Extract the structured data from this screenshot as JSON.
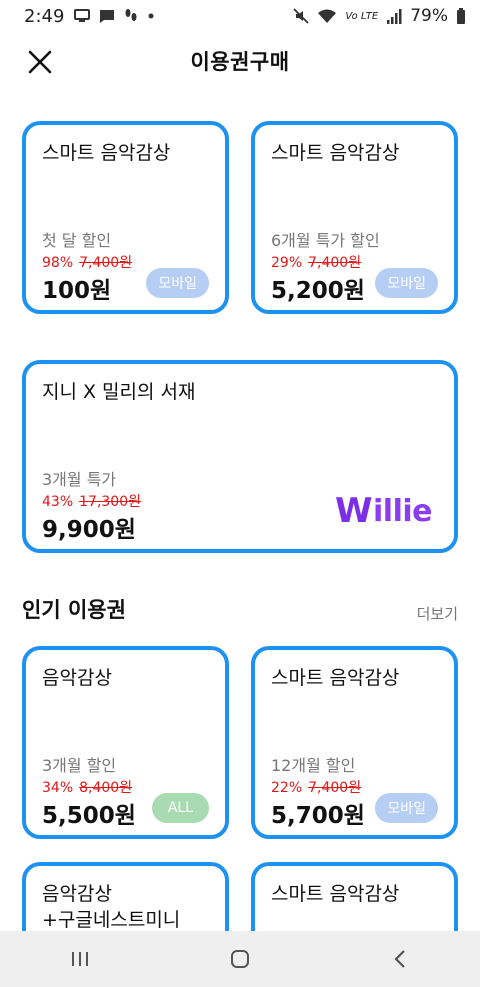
{
  "status_bar": {
    "time": "2:49",
    "battery": "79%",
    "icons_left": [
      "screen-icon",
      "message-icon",
      "footprint-icon",
      "dot-icon"
    ],
    "icons_right": [
      "mute-icon",
      "wifi-icon",
      "volte-icon",
      "signal-icon",
      "battery-icon"
    ]
  },
  "header": {
    "title": "이용권구매",
    "close_icon": "close-icon"
  },
  "top_cards": [
    {
      "name": "스마트 음악감상",
      "promo": "첫 달 할인",
      "discount": "98%",
      "original": "7,400원",
      "price": "100원",
      "badge": "모바일"
    },
    {
      "name": "스마트 음악감상",
      "promo": "6개월 특가 할인",
      "discount": "29%",
      "original": "7,400원",
      "price": "5,200원",
      "badge": "모바일"
    }
  ],
  "wide_card": {
    "name": "지니 X 밀리의 서재",
    "promo": "3개월 특가",
    "discount": "43%",
    "original": "17,300원",
    "price": "9,900원",
    "logo_text": "illie",
    "logo_initial": "W"
  },
  "popular": {
    "title": "인기 이용권",
    "more": "더보기",
    "cards": [
      {
        "name": "음악감상",
        "promo": "3개월 할인",
        "discount": "34%",
        "original": "8,400원",
        "price": "5,500원",
        "badge": "ALL"
      },
      {
        "name": "스마트 음악감상",
        "promo": "12개월 할인",
        "discount": "22%",
        "original": "7,400원",
        "price": "5,700원",
        "badge": "모바일"
      }
    ],
    "partial_cards": [
      {
        "name_line1": "음악감상",
        "name_line2": "+구글네스트미니"
      },
      {
        "name_line1": "스마트 음악감상"
      }
    ]
  },
  "nav_bar": {
    "buttons": [
      "recents-icon",
      "home-icon",
      "back-icon"
    ]
  },
  "colors": {
    "card_border": "#1d92f2",
    "discount": "#e01818",
    "badge_mobile": "#b6cdf4",
    "badge_all": "#a8dbb1",
    "willie": "#8a3ef0"
  }
}
